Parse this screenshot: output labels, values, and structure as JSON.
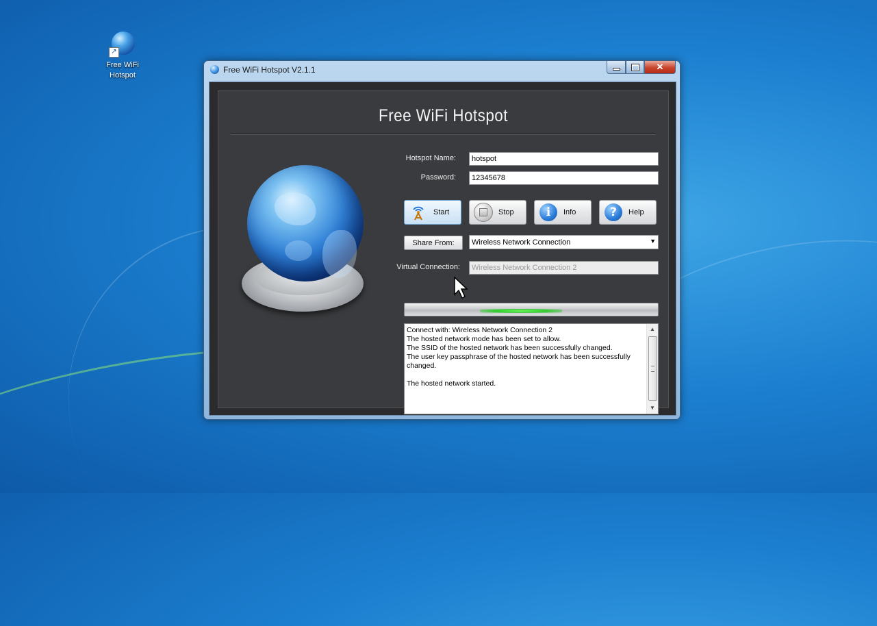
{
  "desktop": {
    "shortcut_label": "Free WiFi Hotspot",
    "shortcut_icon": "globe-shortcut-icon"
  },
  "window": {
    "title": "Free WiFi Hotspot V2.1.1",
    "minimize_icon": "minimize-icon",
    "maximize_icon": "maximize-icon",
    "close_glyph": "✕"
  },
  "app": {
    "heading": "Free WiFi Hotspot",
    "hotspot_name_label": "Hotspot Name:",
    "hotspot_name_value": "hotspot",
    "password_label": "Password:",
    "password_value": "12345678",
    "buttons": {
      "start": "Start",
      "stop": "Stop",
      "info": "Info",
      "help": "Help"
    },
    "share_from_button": "Share From:",
    "share_from_value": "Wireless Network Connection",
    "virtual_connection_label": "Virtual Connection:",
    "virtual_connection_value": "Wireless Network Connection 2",
    "log_text": "Connect with: Wireless Network Connection 2\nThe hosted network mode has been set to allow.\nThe SSID of the hosted network has been successfully changed.\nThe user key passphrase of the hosted network has been successfully changed.\n\nThe hosted network started."
  },
  "colors": {
    "panel_dark": "#3a3b3e",
    "progress_green": "#2ecb2a",
    "info_blue": "#2a7bd8"
  }
}
